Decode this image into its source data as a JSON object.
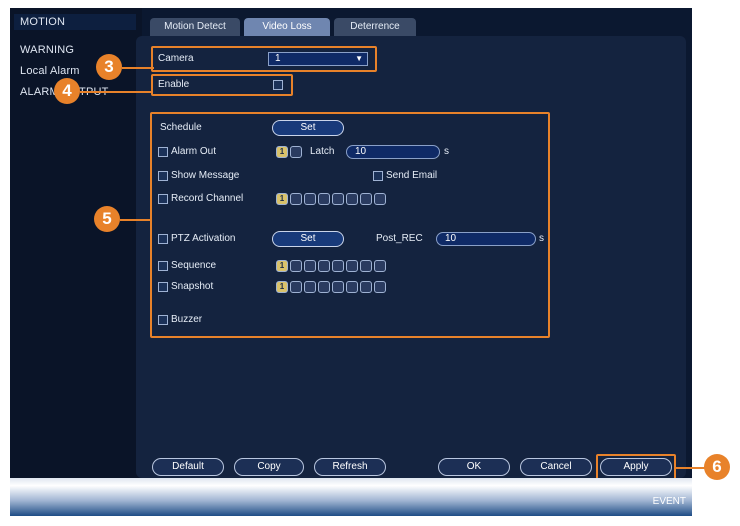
{
  "sidebar": {
    "items": [
      {
        "label": "MOTION",
        "active": true
      },
      {
        "label": "WARNING"
      },
      {
        "label": "Local Alarm"
      },
      {
        "label": "ALARM OUTPUT"
      }
    ]
  },
  "tabs": [
    {
      "label": "Motion Detect"
    },
    {
      "label": "Video Loss",
      "active": true
    },
    {
      "label": "Deterrence"
    }
  ],
  "form": {
    "camera_label": "Camera",
    "camera_value": "1",
    "enable_label": "Enable",
    "schedule_label": "Schedule",
    "schedule_button": "Set",
    "alarm_out_label": "Alarm Out",
    "alarm_out_channel": "1",
    "latch_label": "Latch",
    "latch_value": "10",
    "latch_unit": "s",
    "show_message_label": "Show Message",
    "send_email_label": "Send Email",
    "record_channel_label": "Record Channel",
    "record_channel_first": "1",
    "ptz_label": "PTZ Activation",
    "ptz_button": "Set",
    "post_rec_label": "Post_REC",
    "post_rec_value": "10",
    "post_rec_unit": "s",
    "sequence_label": "Sequence",
    "sequence_first": "1",
    "snapshot_label": "Snapshot",
    "snapshot_first": "1",
    "buzzer_label": "Buzzer"
  },
  "footer": {
    "default": "Default",
    "copy": "Copy",
    "refresh": "Refresh",
    "ok": "OK",
    "cancel": "Cancel",
    "apply": "Apply"
  },
  "callouts": {
    "c3": "3",
    "c4": "4",
    "c5": "5",
    "c6": "6"
  },
  "taskbar": {
    "label": "EVENT"
  },
  "colors": {
    "accent": "#e8822a",
    "background": "#0b1830",
    "panel": "#14233f"
  }
}
